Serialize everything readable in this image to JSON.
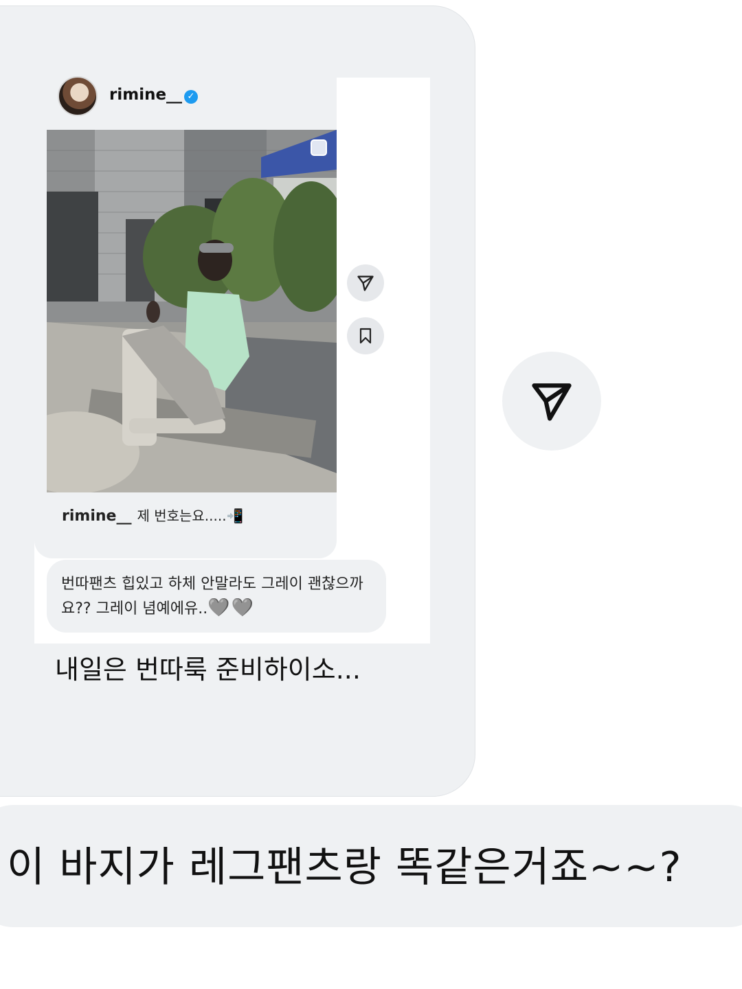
{
  "message": {
    "shared_post": {
      "username": "rimine__",
      "verified": true,
      "caption_user": "rimine__",
      "caption_text": "제 번호는요.....📲",
      "reply_text": "번따팬츠 힙있고 하체 안말라도 그레이 괜찮으까요?? 그레이 념예에유..",
      "reply_emoji": "🩶🩶"
    },
    "bubble_text": "내일은 번따룩 준비하이소..."
  },
  "question_text": "이 바지가 레그팬츠랑 똑같은거죠~~?",
  "icons": {
    "send": "paper-plane-icon",
    "save": "bookmark-icon",
    "multi": "carousel-icon"
  },
  "colors": {
    "bubble": "#eff1f3",
    "verified": "#1d9bf0"
  }
}
